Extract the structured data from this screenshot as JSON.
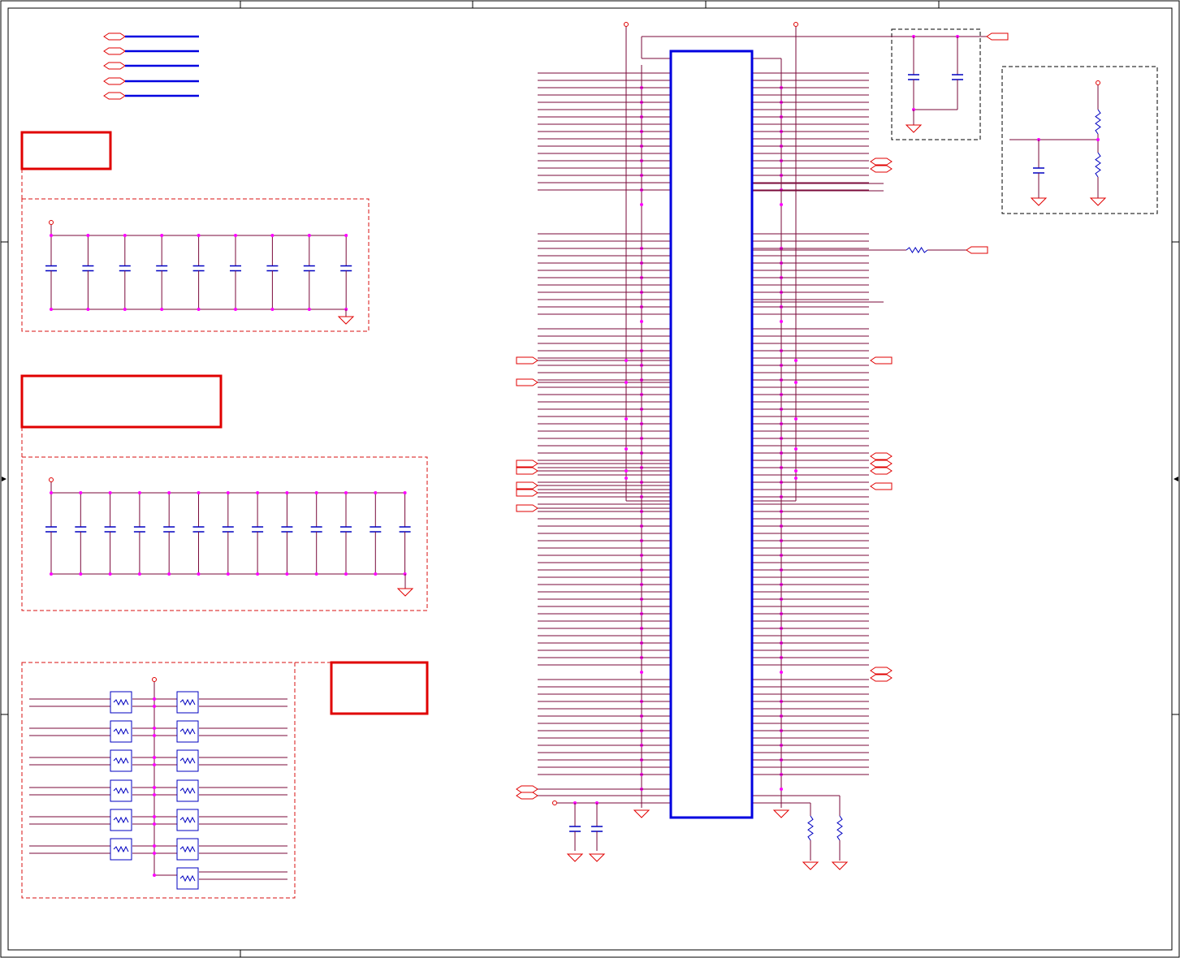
{
  "sheet": {
    "title": "",
    "colors": {
      "wire": "#7a0a3a",
      "symbol": "#e00000",
      "bus": "#0000e0",
      "junction": "#ff00ff",
      "frame": "#000000",
      "title_box": "#e00000",
      "group_box": "#d81010",
      "component": "#0000c0"
    },
    "icons": [
      "capacitor-icon",
      "resistor-icon",
      "ferrite-bead-icon",
      "ground-icon",
      "power-pin-icon",
      "off-page-connector-icon",
      "junction-dot-icon",
      "ic-body-icon"
    ]
  }
}
